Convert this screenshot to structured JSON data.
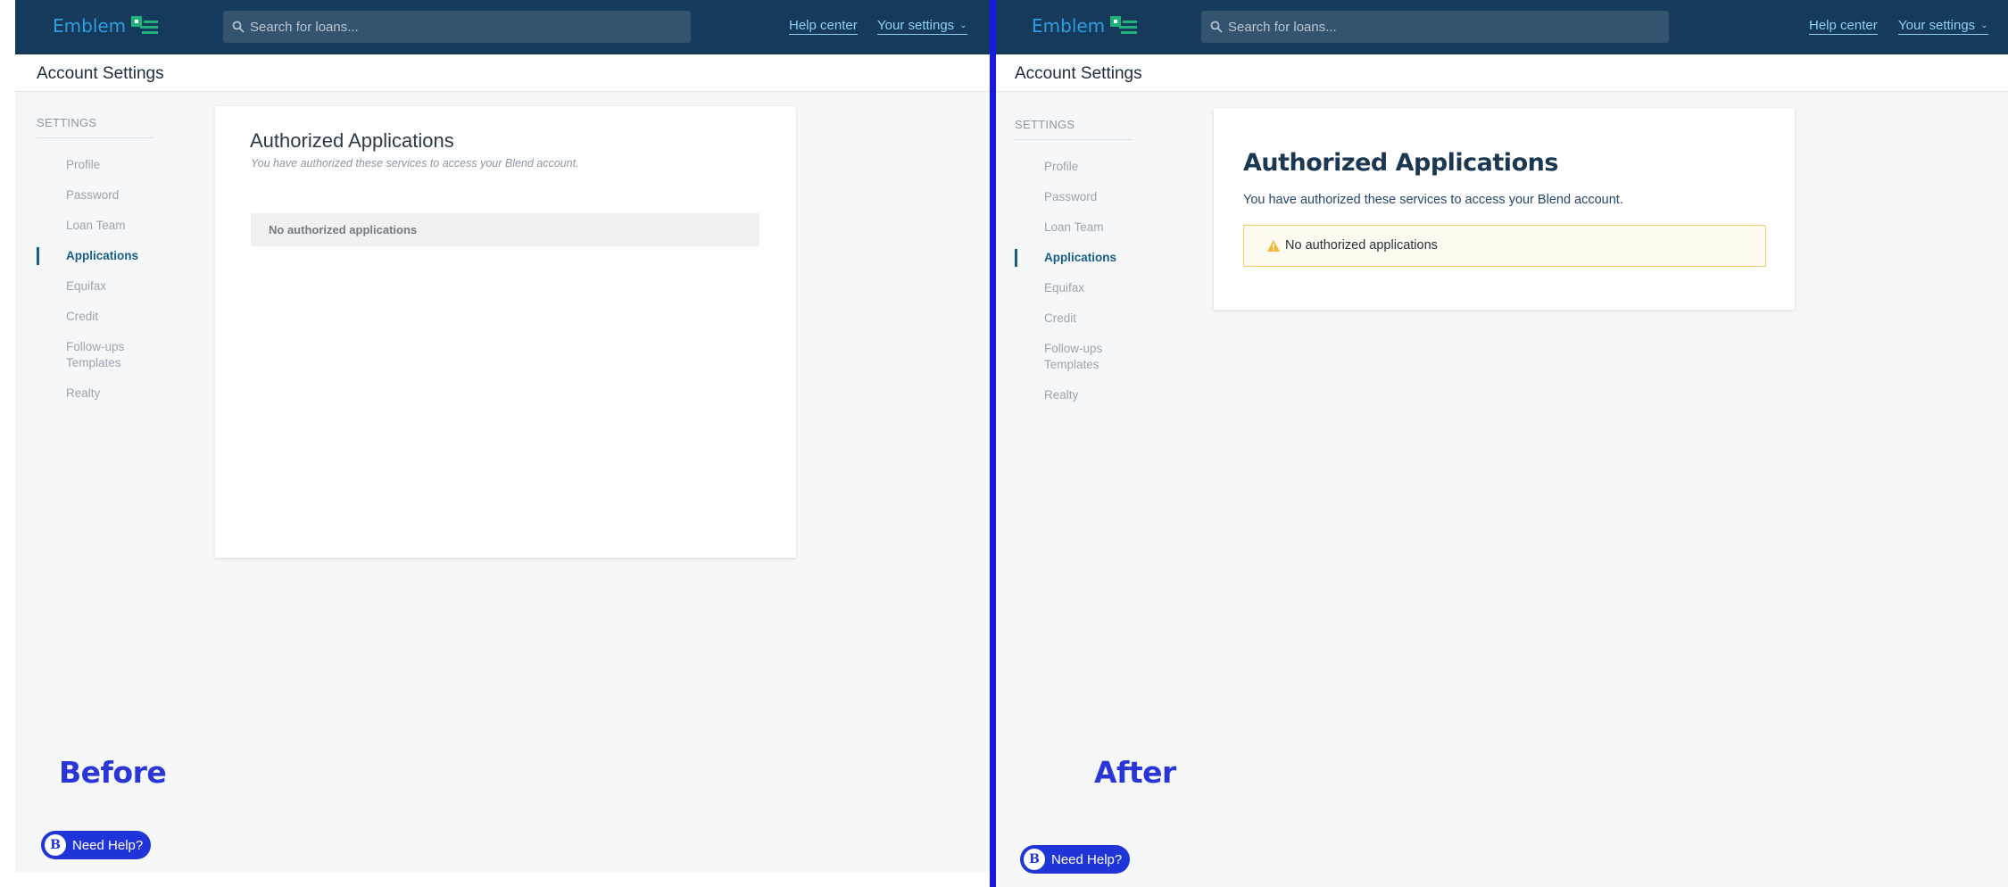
{
  "before": {
    "brand": "Emblem",
    "search_placeholder": "Search for loans...",
    "help_center": "Help center",
    "your_settings": "Your settings",
    "page_title": "Account Settings",
    "sidebar_heading": "SETTINGS",
    "sidebar_items": [
      "Profile",
      "Password",
      "Loan Team",
      "Applications",
      "Equifax",
      "Credit",
      "Follow-ups Templates",
      "Realty"
    ],
    "active_item": "Applications",
    "card_title": "Authorized Applications",
    "card_subtitle": "You have authorized these services to access your Blend account.",
    "empty_message": "No authorized applications",
    "caption": "Before",
    "help_button": "Need Help?",
    "help_badge": "B"
  },
  "after": {
    "brand": "Emblem",
    "search_placeholder": "Search for loans...",
    "help_center": "Help center",
    "your_settings": "Your settings",
    "page_title": "Account Settings",
    "sidebar_heading": "SETTINGS",
    "sidebar_items": [
      "Profile",
      "Password",
      "Loan Team",
      "Applications",
      "Equifax",
      "Credit",
      "Follow-ups Templates",
      "Realty"
    ],
    "active_item": "Applications",
    "card_title": "Authorized Applications",
    "card_subtitle": "You have authorized these services to access your Blend account.",
    "empty_message": "No authorized applications",
    "caption": "After",
    "help_button": "Need Help?",
    "help_badge": "B"
  },
  "colors": {
    "topbar": "#153a5c",
    "accent_link": "#8fd1ee",
    "brand_blue": "#2d9fe0",
    "brand_green": "#1fb37b",
    "divider": "#1919e6",
    "caption": "#2a37d6",
    "alert_border": "#f3cd70",
    "alert_icon": "#f2b632"
  },
  "icons": {
    "search": "search-icon",
    "dropdown": "chevron-down-icon",
    "warning": "warning-icon",
    "logo": "emblem-logo-icon"
  }
}
